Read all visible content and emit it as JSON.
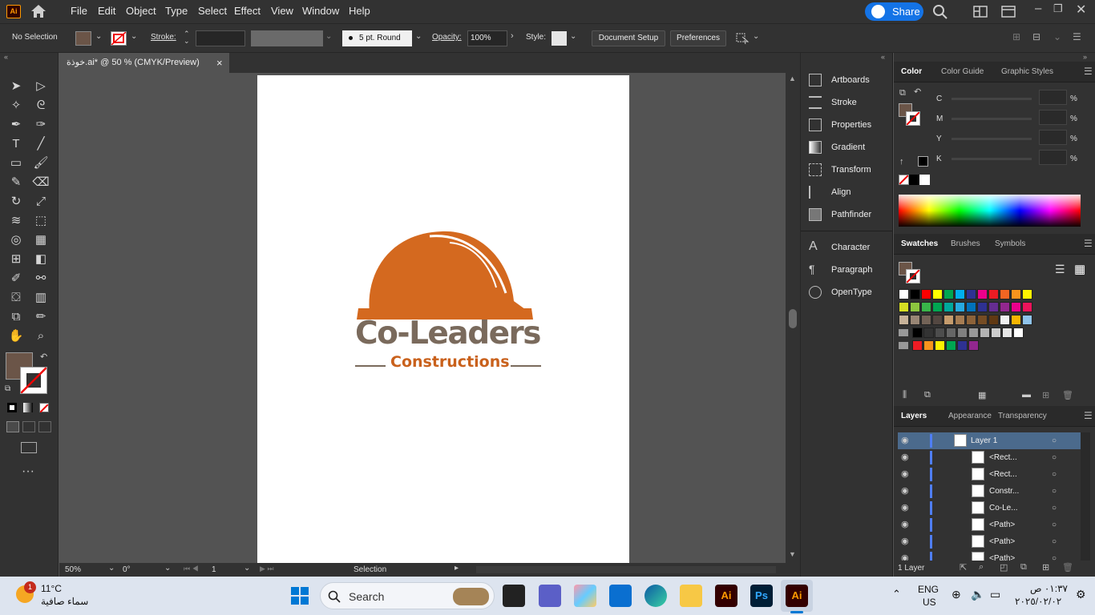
{
  "app": {
    "logo": "Ai",
    "accent": "#ff9a00"
  },
  "menu": [
    "File",
    "Edit",
    "Object",
    "Type",
    "Select",
    "Effect",
    "View",
    "Window",
    "Help"
  ],
  "share_label": "Share",
  "control": {
    "selection": "No Selection",
    "stroke_label": "Stroke:",
    "brush": "5 pt. Round",
    "opacity_label": "Opacity:",
    "opacity_value": "100%",
    "style_label": "Style:",
    "document_setup": "Document Setup",
    "preferences": "Preferences",
    "fill_color": "#6b5548",
    "stroke_color": "none"
  },
  "document": {
    "tab_title": "خوذة.ai* @ 50 % (CMYK/Preview)",
    "close": "×"
  },
  "artwork": {
    "brand_line1": "Co-Leaders",
    "brand_line2": "Constructions",
    "helmet_color": "#d4691f",
    "text_color": "#7a6a5c",
    "sub_color": "#c9611c"
  },
  "status": {
    "zoom": "50%",
    "rotate": "0°",
    "artboard": "1",
    "mode": "Selection"
  },
  "middle_panel": {
    "group1": [
      {
        "label": "Artboards",
        "icon": "artboards-icon"
      },
      {
        "label": "Stroke",
        "icon": "stroke-icon"
      },
      {
        "label": "Properties",
        "icon": "properties-icon"
      },
      {
        "label": "Gradient",
        "icon": "gradient-icon"
      },
      {
        "label": "Transform",
        "icon": "transform-icon"
      },
      {
        "label": "Align",
        "icon": "align-icon"
      },
      {
        "label": "Pathfinder",
        "icon": "pathfinder-icon"
      }
    ],
    "group2": [
      {
        "label": "Character",
        "icon": "character-icon"
      },
      {
        "label": "Paragraph",
        "icon": "paragraph-icon"
      },
      {
        "label": "OpenType",
        "icon": "opentype-icon"
      }
    ]
  },
  "color_panel": {
    "tabs": [
      "Color",
      "Color Guide",
      "Graphic Styles"
    ],
    "channels": [
      "C",
      "M",
      "Y",
      "K"
    ],
    "unit": "%"
  },
  "swatch_panel": {
    "tabs": [
      "Swatches",
      "Brushes",
      "Symbols"
    ],
    "rows": [
      [
        "#ffffff",
        "#000000",
        "#ff0000",
        "#ffff00",
        "#00a651",
        "#00aeef",
        "#2e3192",
        "#ec008c",
        "#ed1c24",
        "#f26522",
        "#f7941d",
        "#fff200"
      ],
      [
        "#d7df23",
        "#8dc63f",
        "#39b54a",
        "#00a651",
        "#00a99d",
        "#27aae1",
        "#0072bc",
        "#2e3192",
        "#662d91",
        "#92278f",
        "#ec008c",
        "#ed145b"
      ],
      [
        "#c7b299",
        "#998675",
        "#736357",
        "#534741",
        "#c69c6d",
        "#a67c52",
        "#8c6239",
        "#754c24",
        "#603913",
        "#f0f0f0",
        "#f7b500",
        "#8fc3ea"
      ],
      [
        "#000000",
        "#333333",
        "#4d4d4d",
        "#666666",
        "#808080",
        "#999999",
        "#b3b3b3",
        "#cccccc",
        "#e6e6e6",
        "#ffffff"
      ],
      [
        "#ed1c24",
        "#f7941d",
        "#fff200",
        "#00a651",
        "#2e3192",
        "#92278f"
      ]
    ]
  },
  "layers_panel": {
    "tabs": [
      "Layers",
      "Appearance",
      "Transparency"
    ],
    "rows": [
      "Layer 1",
      "<Rect...",
      "<Rect...",
      "Constr...",
      "Co-Le...",
      "<Path>",
      "<Path>",
      "<Path>"
    ],
    "footer": "1 Layer"
  },
  "taskbar": {
    "weather_temp": "11°C",
    "weather_desc": "سماء صافية",
    "weather_badge": "1",
    "search": "Search",
    "lang1": "ENG",
    "lang2": "US",
    "time": "٠١:٣٧ ص",
    "date": "٢٠٢٥/٠٢/٠٢"
  }
}
